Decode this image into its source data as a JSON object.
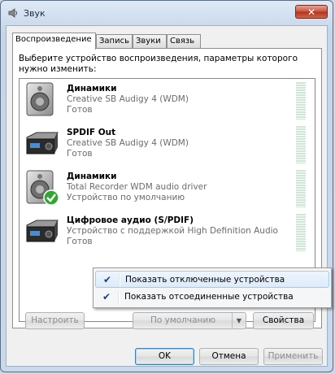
{
  "window": {
    "title": "Звук",
    "close_label": "✕"
  },
  "tabs": [
    {
      "label": "Воспроизведение",
      "active": true
    },
    {
      "label": "Запись",
      "active": false
    },
    {
      "label": "Звуки",
      "active": false
    },
    {
      "label": "Связь",
      "active": false
    }
  ],
  "instruction": "Выберите устройство воспроизведения, параметры которого нужно изменить:",
  "devices": [
    {
      "name": "Динамики",
      "driver": "Creative SB Audigy 4 (WDM)",
      "status": "Готов",
      "icon": "speaker-icon"
    },
    {
      "name": "SPDIF Out",
      "driver": "Creative SB Audigy 4 (WDM)",
      "status": "Готов",
      "icon": "receiver-icon"
    },
    {
      "name": "Динамики",
      "driver": "Total Recorder WDM audio driver",
      "status": "Устройство по умолчанию",
      "icon": "speaker-default-icon"
    },
    {
      "name": "Цифровое аудио (S/PDIF)",
      "driver": "Устройство с поддержкой High Definition Audio",
      "status": "Готов",
      "icon": "receiver-icon"
    }
  ],
  "buttons": {
    "configure": "Настроить",
    "set_default": "По умолчанию",
    "properties": "Свойства",
    "ok": "OK",
    "cancel": "Отмена",
    "apply": "Применить"
  },
  "context_menu": [
    {
      "label": "Показать отключенные устройства",
      "checked": true
    },
    {
      "label": "Показать отсоединенные устройства",
      "checked": true
    }
  ],
  "colors": {
    "accent": "#3c7fb1",
    "default_check": "#2fa82f",
    "meter": "#cfe8d6"
  }
}
